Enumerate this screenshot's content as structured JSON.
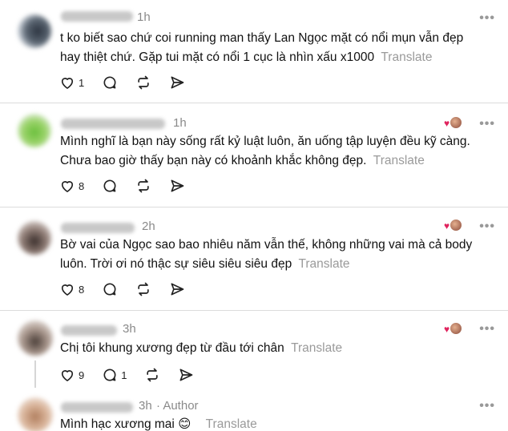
{
  "posts": [
    {
      "time": "1h",
      "text": "t ko biết sao chứ coi running man thấy Lan Ngọc mặt có nổi mụn vẫn đẹp hay thiệt chứ. Gặp tui mặt có nổi 1 cục là nhìn xấu x1000",
      "translate": "Translate",
      "likes": "1",
      "replies": "",
      "liked_by_author": false
    },
    {
      "time": "1h",
      "text": "Mình nghĩ là bạn này sống rất kỷ luật luôn, ăn uống tập luyện đều kỹ càng. Chưa bao giờ thấy bạn này có khoảnh khắc không đẹp.",
      "translate": "Translate",
      "likes": "8",
      "replies": "",
      "liked_by_author": true
    },
    {
      "time": "2h",
      "text": "Bờ vai của Ngọc sao bao nhiêu năm vẫn thế, không những vai mà cả body luôn. Trời ơi nó thậc sự siêu siêu siêu đẹp",
      "translate": "Translate",
      "likes": "8",
      "replies": "",
      "liked_by_author": true
    },
    {
      "time": "3h",
      "text": "Chị tôi khung xương đẹp từ đầu tới chân",
      "translate": "Translate",
      "likes": "9",
      "replies": "1",
      "liked_by_author": true
    },
    {
      "time": "3h",
      "author_label": "· Author",
      "text": "Mình hạc xương mai 😊",
      "translate": "Translate"
    }
  ],
  "more_label": "•••",
  "icons": {
    "like": "heart-outline-icon",
    "reply": "speech-bubble-icon",
    "repost": "repost-icon",
    "share": "send-icon",
    "more": "ellipsis-icon"
  },
  "colors": {
    "liked_heart": "#e0245e",
    "muted_text": "#8a8a8a"
  }
}
